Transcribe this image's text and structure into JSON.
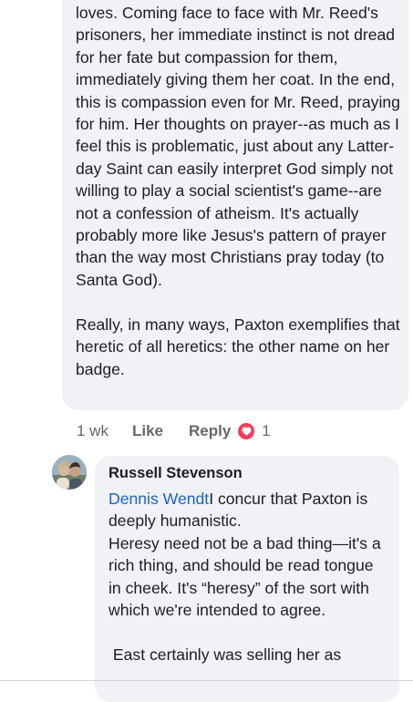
{
  "comment1": {
    "text": "loves. Coming face to face with Mr. Reed's prisoners, her immediate instinct is not dread for her fate but compassion for them, immediately giving them her coat. In the end, this is compassion even for Mr. Reed, praying for him. Her thoughts on prayer--as much as I feel this is problematic, just about any Latter-day Saint can easily interpret God simply not willing to play a social scientist's game--are not a confession of atheism. It's actually probably more like Jesus's pattern of prayer than the way most Christians pray today (to Santa God).\n\nReally, in many ways, Paxton exemplifies that heretic of all heretics: the other name on her badge.",
    "time": "1 wk",
    "like_label": "Like",
    "reply_label": "Reply",
    "reaction_count": "1",
    "reaction_icon": "heart-icon",
    "reaction_color": "#f33e58"
  },
  "comment2": {
    "author": "Russell Stevenson",
    "mention": "Dennis Wendt",
    "text": "I concur that Paxton is deeply humanistic.\nHeresy need not be a bad thing—it's a rich thing, and should be read tongue in cheek. It's “heresy” of the sort with which we're intended to agree.\n\n East certainly was selling her as"
  },
  "colors": {
    "bubble": "#f0f2f5",
    "mention": "#1a63c7",
    "meta": "#65676b"
  }
}
